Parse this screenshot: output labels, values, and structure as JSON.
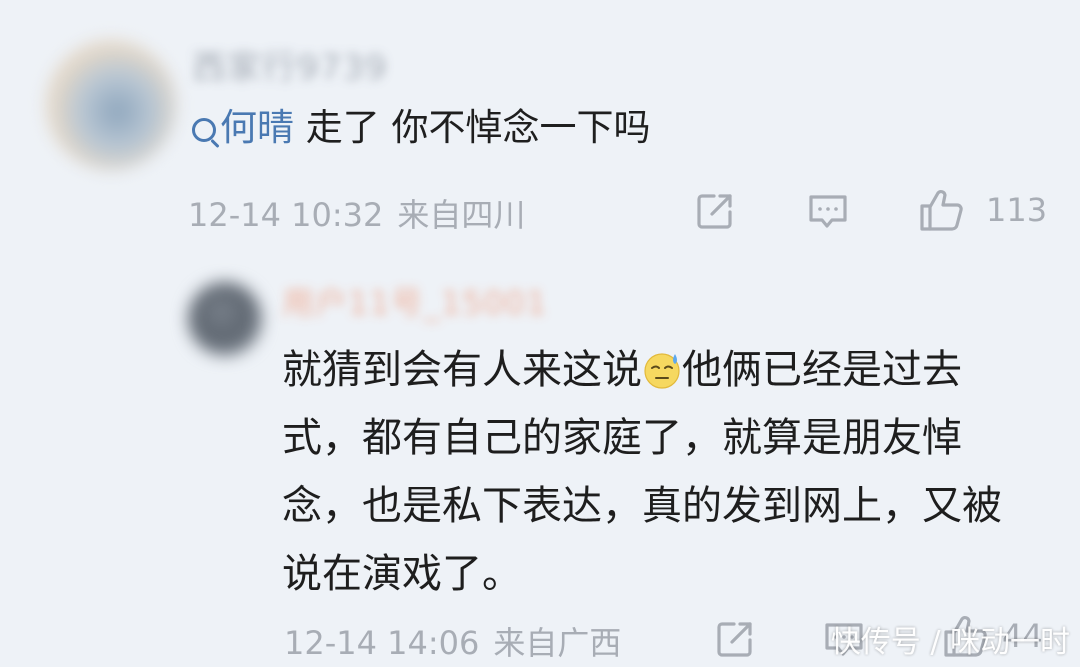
{
  "comment": {
    "username": "西家行9739",
    "mention": "何晴",
    "text": " 走了 你不悼念一下吗",
    "date": "12-14 10:32",
    "region": "来自四川",
    "like_count": "113",
    "icons": {
      "mention": "search-mention-icon",
      "share": "share-icon",
      "comment": "comment-icon",
      "like": "thumbs-up-icon"
    }
  },
  "reply": {
    "username": "用户11号_15001 ",
    "text_before_emoji": "就猜到会有人来这说",
    "emoji": "sweat-smile-emoji",
    "text_after_emoji": "他俩已经是过去式，都有自己的家庭了，就算是朋友悼念，也是私下表达，真的发到网上，又被说在演戏了。",
    "date": "12-14 14:06",
    "region": "来自广西",
    "like_count": "44"
  },
  "watermark": "快传号 / 咪动一时",
  "colors": {
    "background": "#eef2f7",
    "mention": "#4a79b2",
    "meta": "#a8adb5",
    "body_text": "#1e1e1e"
  }
}
